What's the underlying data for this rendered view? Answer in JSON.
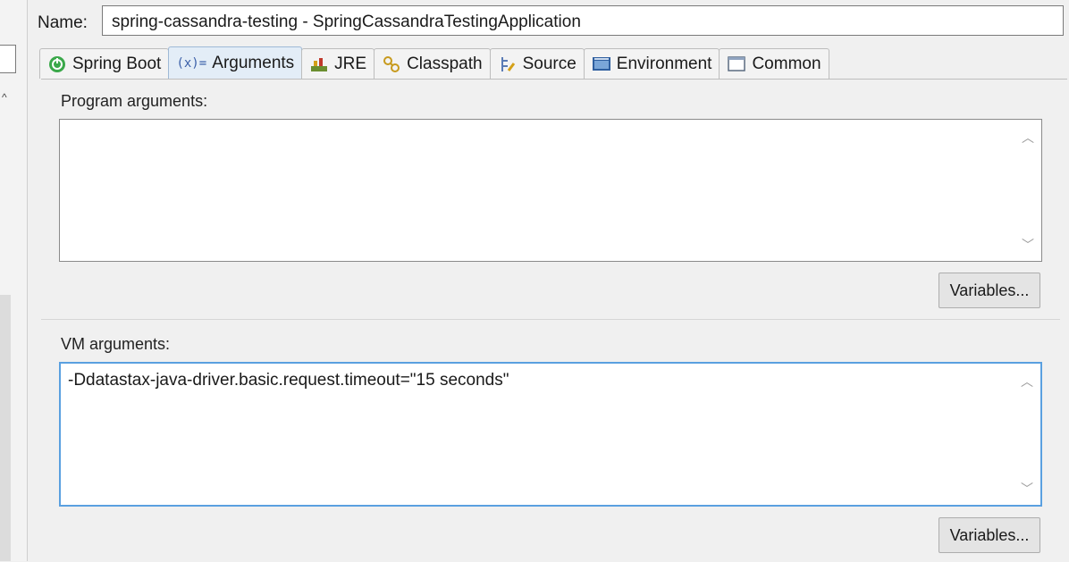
{
  "name": {
    "label": "Name:",
    "value": "spring-cassandra-testing - SpringCassandraTestingApplication"
  },
  "tabs": [
    {
      "label": "Spring Boot",
      "icon": "spring-boot-icon",
      "active": false
    },
    {
      "label": "Arguments",
      "icon": "arguments-icon",
      "active": true
    },
    {
      "label": "JRE",
      "icon": "jre-icon",
      "active": false
    },
    {
      "label": "Classpath",
      "icon": "classpath-icon",
      "active": false
    },
    {
      "label": "Source",
      "icon": "source-icon",
      "active": false
    },
    {
      "label": "Environment",
      "icon": "environment-icon",
      "active": false
    },
    {
      "label": "Common",
      "icon": "common-icon",
      "active": false
    }
  ],
  "program_args": {
    "label": "Program arguments:",
    "value": "",
    "variables_label": "Variables..."
  },
  "vm_args": {
    "label": "VM arguments:",
    "value": "-Ddatastax-java-driver.basic.request.timeout=\"15 seconds\"",
    "variables_label": "Variables..."
  },
  "colors": {
    "active_tab": "#e3edf7",
    "focus_border": "#5aa0e0"
  }
}
